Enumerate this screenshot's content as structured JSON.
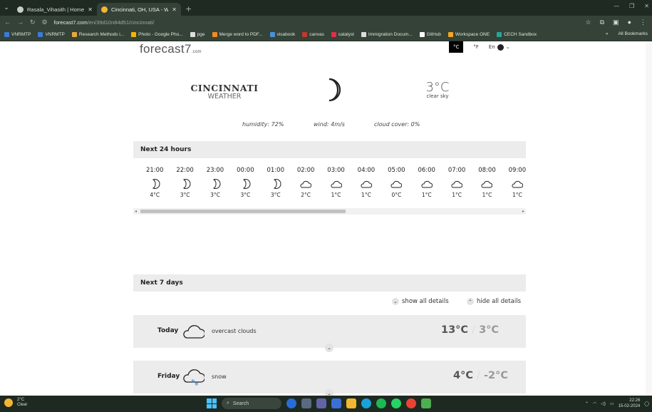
{
  "browser": {
    "tabs": [
      {
        "title": "Rasala_Vihasith | Home",
        "active": false
      },
      {
        "title": "Cincinnati, OH, USA - Weather",
        "active": true
      }
    ],
    "url_host": "forecast7.com",
    "url_path": "/en/39d10n84d51/cincinnati/",
    "bookmarks": [
      "VNRMTP",
      "VNRMTP",
      "Research Methods i...",
      "Photo - Google Pho...",
      "pge",
      "Merge word to PDF...",
      "visabook",
      "canvas",
      "catalyst",
      "Immigration Docum...",
      "GitHub",
      "Workspace ONE",
      "CECH Sandbox"
    ],
    "bookmark_colors": [
      "#3a7bd5",
      "#3a7bd5",
      "#e8a93a",
      "#f4b400",
      "#dddddd",
      "#f28b20",
      "#4a90d9",
      "#c0392b",
      "#e0304a",
      "#dddddd",
      "#ffffff",
      "#f5a623",
      "#26a69a"
    ],
    "all_bookmarks": "All Bookmarks"
  },
  "site": {
    "logo": "forecast7",
    "logo_suffix": ".com",
    "unit_c": "°C",
    "unit_f": "°F",
    "lang": "En"
  },
  "current": {
    "city": "CINCINNATI",
    "subtitle": "WEATHER",
    "temp": "3°C",
    "desc": "clear sky",
    "humidity": "humidity: 72%",
    "wind": "wind: 4m/s",
    "cloud": "cloud cover: 0%"
  },
  "hourly": {
    "title": "Next 24 hours",
    "items": [
      {
        "time": "21:00",
        "icon": "moon-icon",
        "temp": "4°C"
      },
      {
        "time": "22:00",
        "icon": "moon-icon",
        "temp": "3°C"
      },
      {
        "time": "23:00",
        "icon": "moon-icon",
        "temp": "3°C"
      },
      {
        "time": "00:00",
        "icon": "moon-icon",
        "temp": "3°C"
      },
      {
        "time": "01:00",
        "icon": "moon-icon",
        "temp": "3°C"
      },
      {
        "time": "02:00",
        "icon": "cloud-icon",
        "temp": "2°C"
      },
      {
        "time": "03:00",
        "icon": "cloud-icon",
        "temp": "1°C"
      },
      {
        "time": "04:00",
        "icon": "cloud-icon",
        "temp": "1°C"
      },
      {
        "time": "05:00",
        "icon": "cloud-icon",
        "temp": "0°C"
      },
      {
        "time": "06:00",
        "icon": "cloud-icon",
        "temp": "1°C"
      },
      {
        "time": "07:00",
        "icon": "cloud-icon",
        "temp": "1°C"
      },
      {
        "time": "08:00",
        "icon": "cloud-icon",
        "temp": "1°C"
      },
      {
        "time": "09:00",
        "icon": "cloud-icon",
        "temp": "1°C"
      }
    ]
  },
  "daily": {
    "title": "Next 7 days",
    "show_all": "show all details",
    "hide_all": "hide all details",
    "days": [
      {
        "label": "Today",
        "icon": "cloud-icon",
        "desc": "overcast clouds",
        "hi": "13°C",
        "lo": "3°C"
      },
      {
        "label": "Friday",
        "icon": "snow-cloud-icon",
        "desc": "snow",
        "hi": "4°C",
        "lo": "-2°C"
      }
    ]
  },
  "taskbar": {
    "weather_temp": "2°C",
    "weather_desc": "Clear",
    "search": "Search",
    "time": "22:26",
    "date": "15-02-2024"
  }
}
